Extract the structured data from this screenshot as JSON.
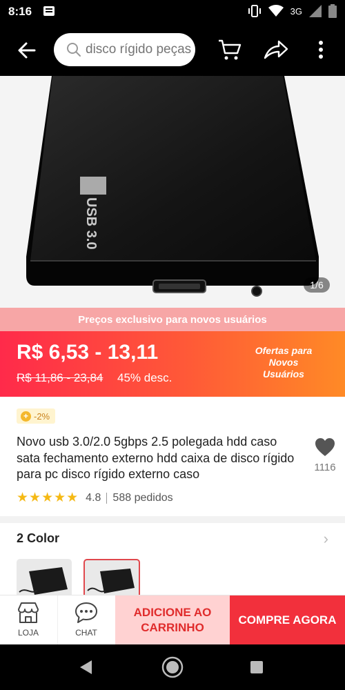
{
  "status_bar": {
    "time": "8:16",
    "network": "3G",
    "icons": [
      "notification-icon",
      "vibrate-icon",
      "wifi-icon",
      "signal-icon",
      "battery-icon"
    ]
  },
  "header": {
    "search_placeholder": "disco rígido peças",
    "icons": [
      "back-arrow-icon",
      "search-icon",
      "cart-icon",
      "share-icon",
      "more-icon"
    ]
  },
  "gallery": {
    "counter": "1/6",
    "label_on_device": "USB 3.0"
  },
  "promo": {
    "banner": "Preços exclusivo para novos usuários",
    "price_range": "R$ 6,53 - 13,11",
    "old_price": "R$ 11,86 - 23,84",
    "discount": "45% desc.",
    "offer_line1": "Ofertas para",
    "offer_line2": "Novos",
    "offer_line3": "Usuários"
  },
  "product": {
    "coupon": "-2%",
    "title": "Novo usb 3.0/2.0 5gbps 2.5 polegada hdd caso sata fechamento externo hdd caixa de disco rígido para pc disco rígido externo caso",
    "favorites": "1116",
    "rating": "4.8",
    "orders": "588 pedidos",
    "stars": "★★★★★"
  },
  "variants": {
    "heading": "2 Color",
    "selected_index": 1
  },
  "actions": {
    "store": "LOJA",
    "chat": "CHAT",
    "add_cart_line1": "ADICIONE AO",
    "add_cart_line2": "CARRINHO",
    "buy": "COMPRE AGORA"
  },
  "colors": {
    "accent": "#f2303c",
    "star": "#f5b914",
    "promo_gradient_start": "#ff2a4a",
    "promo_gradient_end": "#ff8a26"
  }
}
